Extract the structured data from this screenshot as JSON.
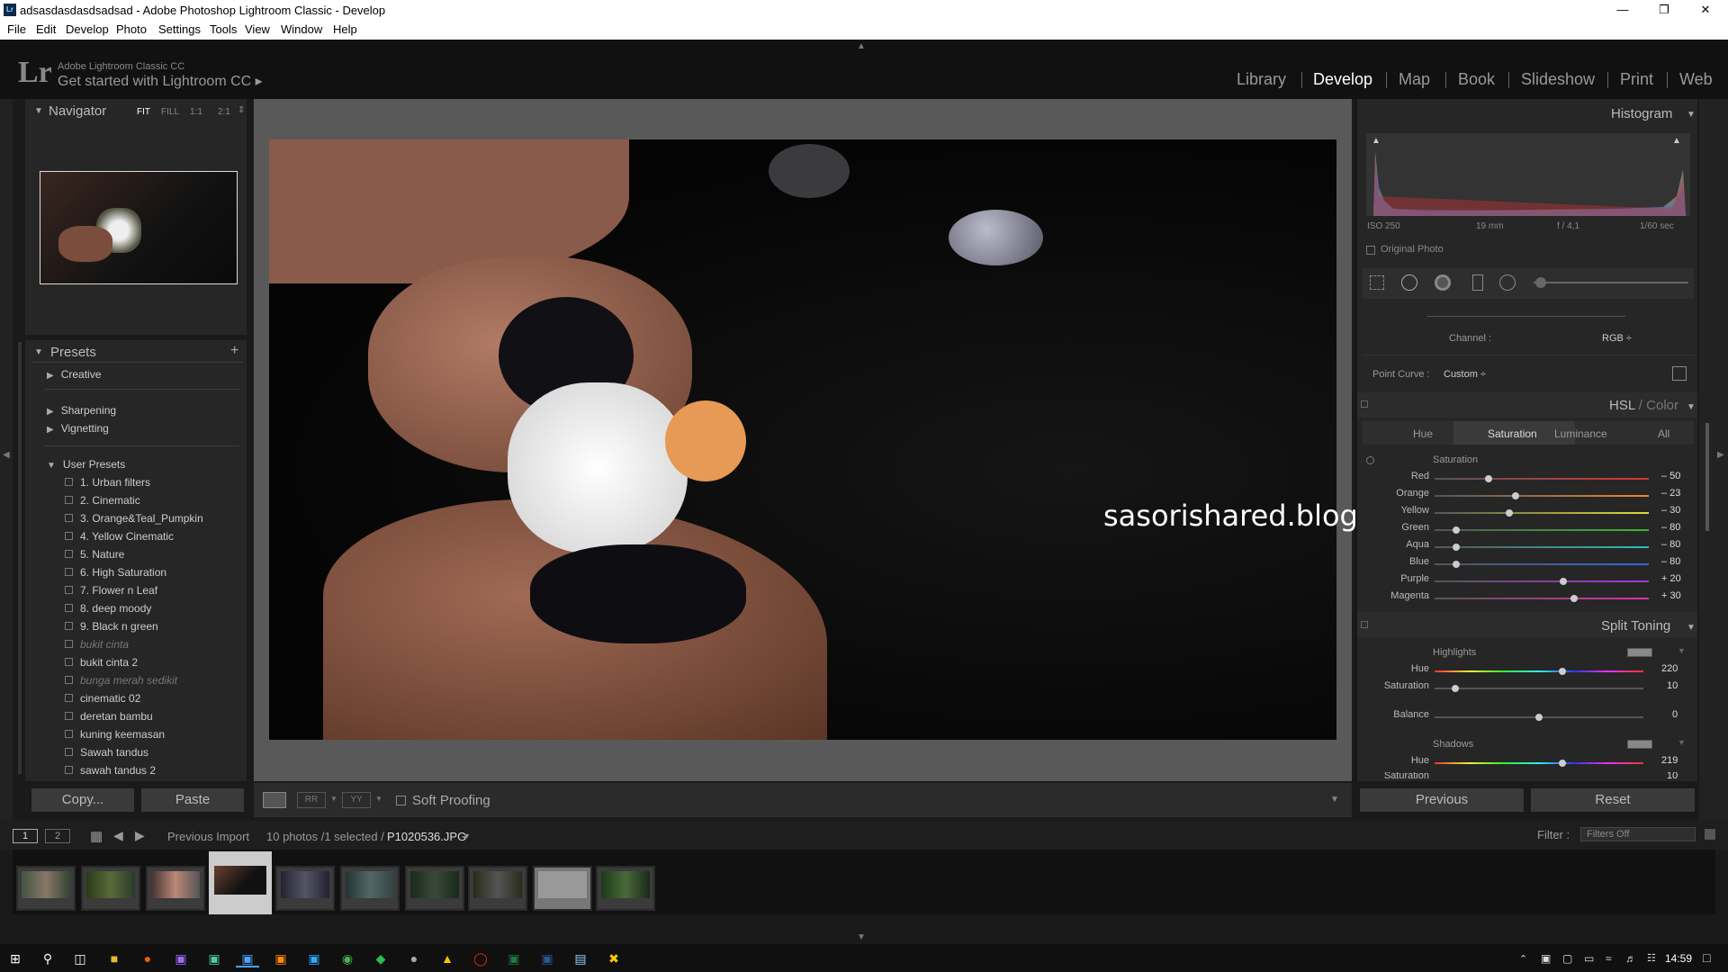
{
  "window": {
    "title": "adsasdasdasdsadsad - Adobe Photoshop Lightroom Classic - Develop",
    "app_icon": "Lr"
  },
  "menu": [
    "File",
    "Edit",
    "Develop",
    "Photo",
    "Settings",
    "Tools",
    "View",
    "Window",
    "Help"
  ],
  "brand": {
    "logo": "Lr",
    "line1": "Adobe Lightroom Classic CC",
    "line2": "Get started with Lightroom CC ▸"
  },
  "modules": [
    "Library",
    "Develop",
    "Map",
    "Book",
    "Slideshow",
    "Print",
    "Web"
  ],
  "navigator": {
    "title": "Navigator",
    "zoom": [
      "FIT",
      "FILL",
      "1:1",
      "2:1"
    ]
  },
  "presets": {
    "title": "Presets",
    "groups": [
      "Creative",
      "Sharpening",
      "Vignetting",
      "User Presets"
    ],
    "user": [
      "1. Urban filters",
      "2. Cinematic",
      "3. Orange&Teal_Pumpkin",
      "4. Yellow Cinematic",
      "5. Nature",
      "6. High Saturation",
      "7. Flower n Leaf",
      "8. deep moody",
      "9. Black n green",
      "bukit cinta",
      "bukit cinta 2",
      "bunga merah sedikit",
      "cinematic 02",
      "deretan bambu",
      "kuning keemasan",
      "Sawah tandus",
      "sawah tandus 2"
    ]
  },
  "left_buttons": {
    "copy": "Copy...",
    "paste": "Paste"
  },
  "toolbar": {
    "soft_proofing": "Soft Proofing"
  },
  "watermark": "sasorishared.blogspot.com",
  "histogram": {
    "title": "Histogram",
    "iso": "ISO 250",
    "focal": "19 mm",
    "aperture": "f / 4,1",
    "shutter": "1/60 sec",
    "original": "Original Photo"
  },
  "tone_curve": {
    "channel_label": "Channel :",
    "channel_value": "RGB ÷",
    "point_curve_label": "Point Curve :",
    "point_curve_value": "Custom ÷"
  },
  "hsl": {
    "title_a": "HSL",
    "title_sep": " / ",
    "title_b": "Color",
    "tabs": [
      "Hue",
      "Saturation",
      "Luminance",
      "All"
    ],
    "section": "Saturation",
    "rows": [
      {
        "label": "Red",
        "value": "– 50",
        "pos": 0.25,
        "color": "#d33"
      },
      {
        "label": "Orange",
        "value": "– 23",
        "pos": 0.38,
        "color": "#e83"
      },
      {
        "label": "Yellow",
        "value": "– 30",
        "pos": 0.35,
        "color": "#dd3"
      },
      {
        "label": "Green",
        "value": "– 80",
        "pos": 0.1,
        "color": "#3b3"
      },
      {
        "label": "Aqua",
        "value": "– 80",
        "pos": 0.1,
        "color": "#3bb"
      },
      {
        "label": "Blue",
        "value": "– 80",
        "pos": 0.1,
        "color": "#36d"
      },
      {
        "label": "Purple",
        "value": "+ 20",
        "pos": 0.6,
        "color": "#a3d"
      },
      {
        "label": "Magenta",
        "value": "+ 30",
        "pos": 0.65,
        "color": "#d3a"
      }
    ]
  },
  "split": {
    "title": "Split Toning",
    "highlights": "Highlights",
    "hue_label": "Hue",
    "hue_value": "220",
    "hue_pos": 0.61,
    "sat_label": "Saturation",
    "sat_value": "10",
    "sat_pos": 0.1,
    "balance_label": "Balance",
    "balance_value": "0",
    "balance_pos": 0.5,
    "shadows": "Shadows",
    "sh_hue_label": "Hue",
    "sh_hue_value": "219",
    "sh_hue_pos": 0.61,
    "sh_sat_label": "Saturation",
    "sh_sat_value": "10"
  },
  "right_buttons": {
    "previous": "Previous",
    "reset": "Reset"
  },
  "filmstrip": {
    "page1": "1",
    "page2": "2",
    "source": "Previous Import",
    "count": "10 photos /1 selected /",
    "file": "P1020536.JPG",
    "filter_label": "Filter :",
    "filter_value": "Filters Off"
  },
  "taskbar": {
    "time": "14:59"
  }
}
